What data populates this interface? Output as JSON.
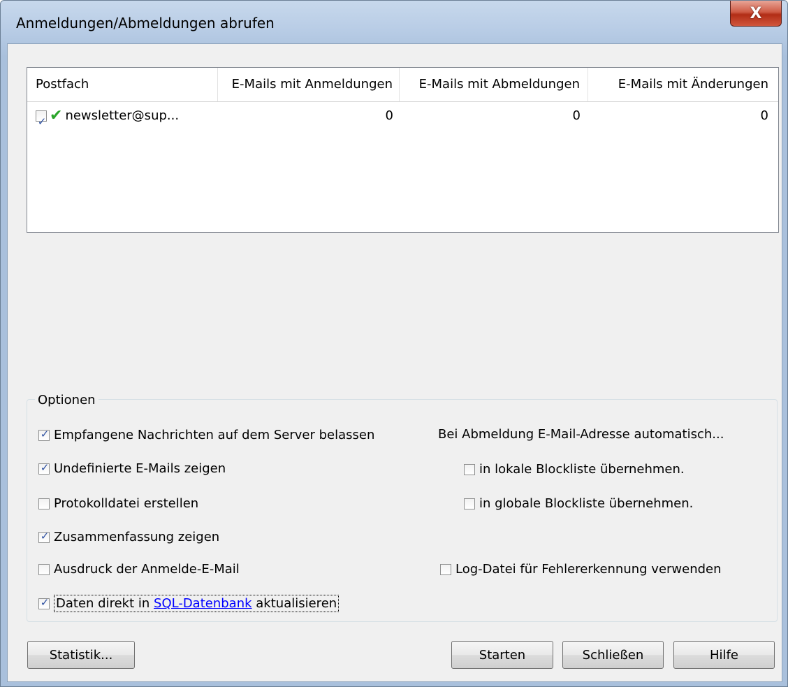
{
  "window": {
    "title": "Anmeldungen/Abmeldungen abrufen",
    "close_label": "X"
  },
  "list": {
    "columns": [
      "Postfach",
      "E-Mails mit Anmeldungen",
      "E-Mails mit Abmeldungen",
      "E-Mails mit Änderungen"
    ],
    "rows": [
      {
        "checked": true,
        "postfach": "newsletter@sup...",
        "anmeldungen": "0",
        "abmeldungen": "0",
        "aenderungen": "0"
      }
    ]
  },
  "options": {
    "group_label": "Optionen",
    "left": [
      {
        "label": "Empfangene Nachrichten auf dem Server belassen",
        "checked": true
      },
      {
        "label": "Undefinierte E-Mails zeigen",
        "checked": true
      },
      {
        "label": "Protokolldatei erstellen",
        "checked": false
      },
      {
        "label": "Zusammenfassung zeigen",
        "checked": true
      },
      {
        "label": "Ausdruck der Anmelde-E-Mail",
        "checked": false
      }
    ],
    "sql": {
      "prefix": "Daten direkt in",
      "link": "SQL-Datenbank",
      "suffix": "aktualisieren",
      "checked": true
    },
    "abmeldung_heading": "Bei Abmeldung E-Mail-Adresse automatisch...",
    "lokal": {
      "label": "in lokale Blockliste übernehmen.",
      "checked": false
    },
    "global": {
      "label": "in globale Blockliste übernehmen.",
      "checked": false
    },
    "logfile": {
      "label": "Log-Datei für Fehlererkennung verwenden",
      "checked": false
    }
  },
  "buttons": {
    "statistik": "Statistik...",
    "starten": "Starten",
    "schliessen": "Schließen",
    "hilfe": "Hilfe"
  },
  "colors": {
    "link": "#0000ff",
    "check_icon": "#2aa52a",
    "close_button": "#c9462f"
  }
}
